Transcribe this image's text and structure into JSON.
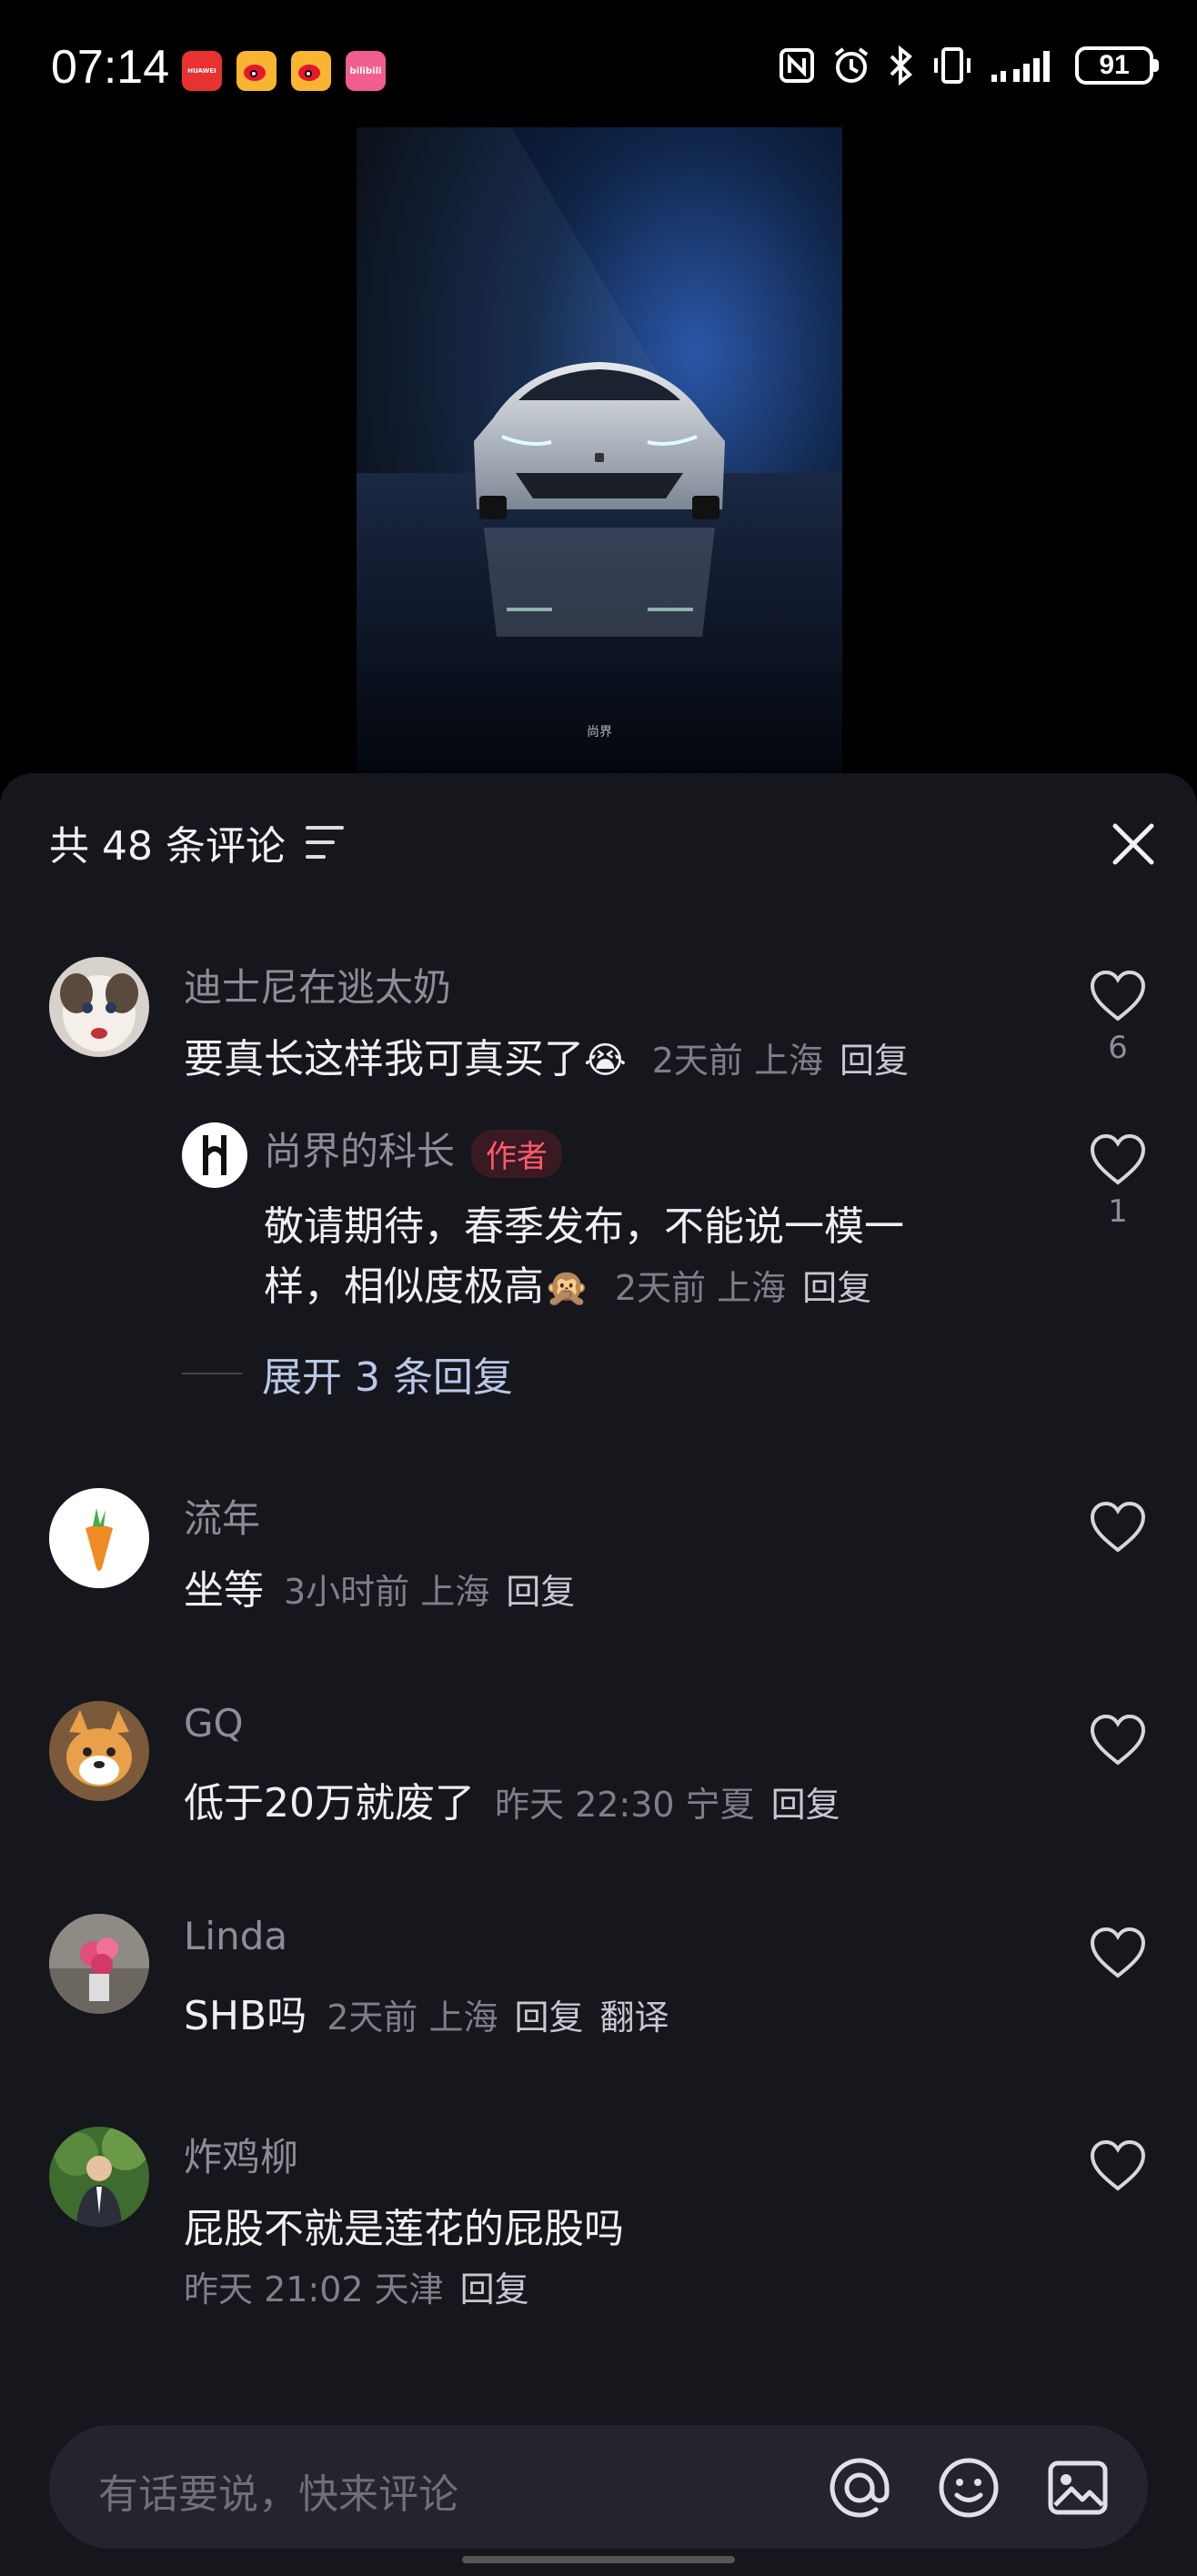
{
  "status_bar": {
    "time": "07:14",
    "battery": "91",
    "apps": [
      {
        "name": "huawei-app-icon",
        "label": "HUAWEI",
        "color": "#e8322f"
      },
      {
        "name": "weibo-icon",
        "label": "",
        "color": "#f8b531"
      },
      {
        "name": "weibo-icon",
        "label": "",
        "color": "#f8b531"
      },
      {
        "name": "bilibili-icon",
        "label": "bilibili",
        "color": "#f25d8e"
      }
    ]
  },
  "media": {
    "watermark": "尚界"
  },
  "sheet": {
    "title": "共 48 条评论",
    "input_placeholder": "有话要说，快来评论"
  },
  "comments": [
    {
      "name": "迪士尼在逃太奶",
      "text": "要真长这样我可真买了",
      "emoji": "😭",
      "meta": "2天前 上海",
      "reply": "回复",
      "likes": "6",
      "replies": [
        {
          "name": "尚界的科长",
          "tag": "作者",
          "text_line1": "敬请期待，春季发布，不能说一模一",
          "text_line2": "样，相似度极高",
          "emoji": "🙊",
          "meta": "2天前 上海",
          "reply": "回复",
          "likes": "1"
        }
      ],
      "expand_label": "展开 3 条回复"
    },
    {
      "name": "流年",
      "text": "坐等",
      "meta": "3小时前 上海",
      "reply": "回复",
      "likes": ""
    },
    {
      "name": "GQ",
      "text": "低于20万就废了",
      "meta": "昨天 22:30 宁夏",
      "reply": "回复",
      "likes": ""
    },
    {
      "name": "Linda",
      "text": "SHB吗",
      "meta": "2天前 上海",
      "reply": "回复",
      "translate": "翻译",
      "likes": ""
    },
    {
      "name": "炸鸡柳",
      "text": "屁股不就是莲花的屁股吗",
      "meta": "昨天 21:02 天津",
      "reply": "回复",
      "likes": ""
    }
  ],
  "colors": {
    "sheet_bg": "#16161d",
    "author_tag": "#ff5a6e",
    "accent_link": "#b9c7e8"
  }
}
